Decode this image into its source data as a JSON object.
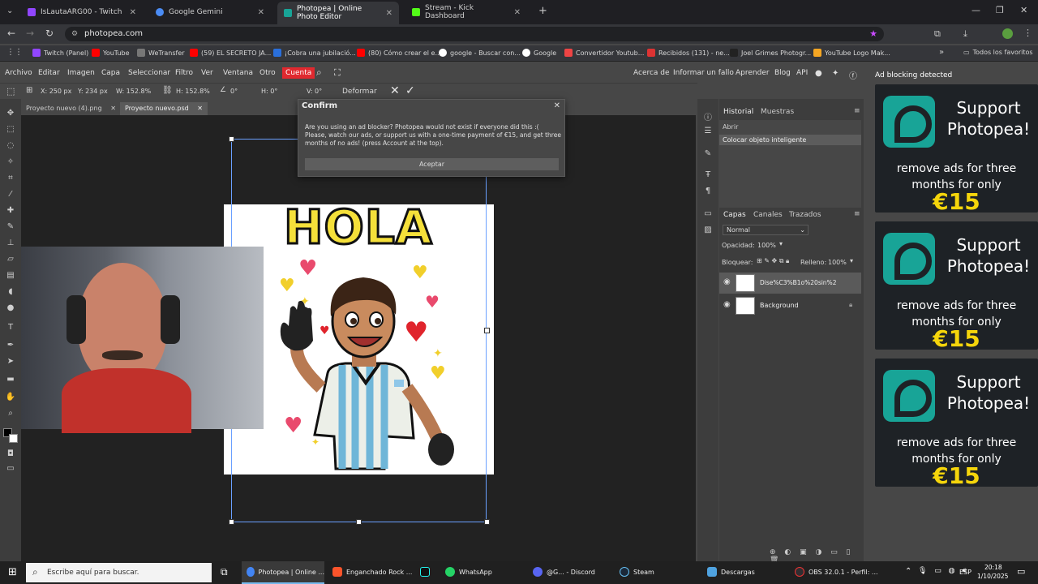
{
  "browser": {
    "tabs": [
      {
        "label": "IsLautaARG00 - Twitch",
        "color": "#9146ff"
      },
      {
        "label": "Google Gemini",
        "color": "#4b8cf5"
      },
      {
        "label": "Photopea | Online Photo Editor",
        "color": "#18a497"
      },
      {
        "label": "Stream - Kick Dashboard",
        "color": "#53fc18"
      }
    ],
    "url": "photopea.com",
    "bookmarks": [
      "Twitch (Panel)",
      "YouTube",
      "WeTransfer",
      "(59) EL SECRETO JA...",
      "¡Cobra una jubilació...",
      "(80) Cómo crear el e...",
      "google - Buscar con...",
      "Google",
      "Convertidor Youtub...",
      "Recibidos (131) - ne...",
      "Joel Grimes Photogr...",
      "YouTube Logo Mak..."
    ],
    "all_favorites": "Todos los favoritos"
  },
  "menubar": {
    "items": [
      "Archivo",
      "Editar",
      "Imagen",
      "Capa",
      "Seleccionar",
      "Filtro",
      "Ver",
      "Ventana",
      "Otro"
    ],
    "account": "Cuenta",
    "right_items": [
      "Acerca de",
      "Informar un fallo",
      "Aprender",
      "Blog",
      "API"
    ]
  },
  "options": {
    "x": "X: 250 px",
    "y": "Y: 234 px",
    "w": "W: 152.8%",
    "h": "H: 152.8%",
    "angle": "0°",
    "hskew": "H: 0°",
    "vskew": "V: 0°",
    "warp": "Deformar"
  },
  "doc_tabs": [
    "Proyecto nuevo (4).png",
    "Proyecto nuevo.psd"
  ],
  "canvas": {
    "text": "HOLA"
  },
  "dialog": {
    "title": "Confirm",
    "message": "Are you using an ad blocker? Photopea would not exist if everyone did this :( Please, watch our ads, or support us with a one-time payment of €15, and get three months of no ads! (press Account at the top).",
    "button": "Aceptar"
  },
  "history": {
    "tabs": [
      "Historial",
      "Muestras"
    ],
    "items": [
      "Abrir",
      "Colocar objeto inteligente"
    ]
  },
  "layers": {
    "tabs": [
      "Capas",
      "Canales",
      "Trazados"
    ],
    "blend": "Normal",
    "opacity_label": "Opacidad:",
    "opacity": "100%",
    "lock_label": "Bloquear:",
    "fill_label": "Relleno:",
    "fill": "100%",
    "items": [
      "Dise%C3%B1o%20sin%2",
      "Background"
    ]
  },
  "ads": {
    "header": "Ad blocking detected",
    "title": "Support Photopea!",
    "text": "remove ads for three months for only",
    "price": "€15"
  },
  "taskbar": {
    "search": "Escribe aquí para buscar.",
    "apps": [
      "Photopea | Online ...",
      "Enganchado Rock ...",
      "WhatsApp",
      "@G... - Discord",
      "Steam",
      "Descargas",
      "OBS 32.0.1 - Perfil: ..."
    ],
    "lang": "ESP",
    "time": "20:18",
    "date": "1/10/2025"
  }
}
